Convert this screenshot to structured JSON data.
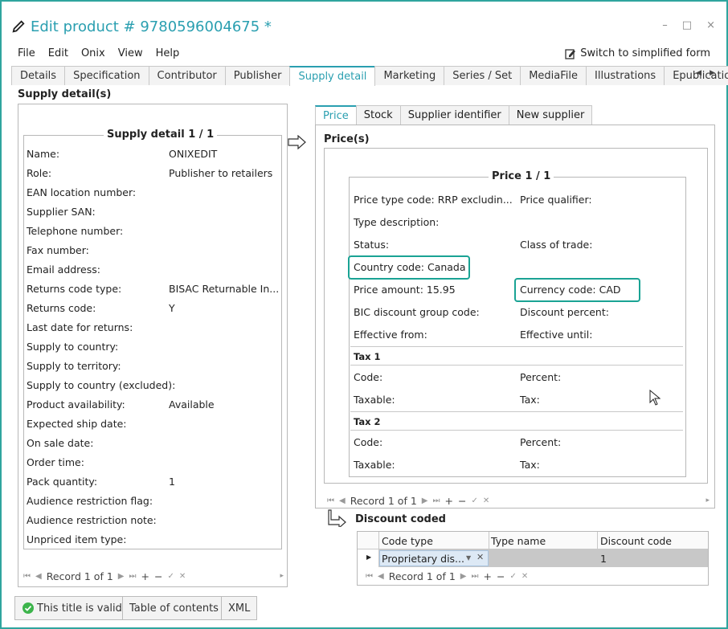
{
  "window": {
    "title": "Edit product # 9780596004675 *",
    "minimize": "–",
    "maximize": "□",
    "close": "×"
  },
  "menu": [
    "File",
    "Edit",
    "Onix",
    "View",
    "Help"
  ],
  "switch_label": "Switch to simplified form",
  "tabs": [
    "Details",
    "Specification",
    "Contributor",
    "Publisher",
    "Supply detail",
    "Marketing",
    "Series / Set",
    "MediaFile",
    "Illustrations",
    "Epublication"
  ],
  "left": {
    "section_title": "Supply detail(s)",
    "legend": "Supply detail 1 / 1",
    "fields": [
      {
        "label": "Name:",
        "value": "ONIXEDIT"
      },
      {
        "label": "Role:",
        "value": "Publisher to retailers"
      },
      {
        "label": "EAN location number:",
        "value": ""
      },
      {
        "label": "Supplier SAN:",
        "value": ""
      },
      {
        "label": "Telephone number:",
        "value": ""
      },
      {
        "label": "Fax number:",
        "value": ""
      },
      {
        "label": "Email address:",
        "value": ""
      },
      {
        "label": "Returns code type:",
        "value": "BISAC Returnable In..."
      },
      {
        "label": "Returns code:",
        "value": "Y"
      },
      {
        "label": "Last date for returns:",
        "value": ""
      },
      {
        "label": "Supply to country:",
        "value": ""
      },
      {
        "label": "Supply to territory:",
        "value": ""
      },
      {
        "label": "Supply to country (excluded):",
        "value": ""
      },
      {
        "label": "Product availability:",
        "value": "Available"
      },
      {
        "label": "Expected ship date:",
        "value": ""
      },
      {
        "label": "On sale date:",
        "value": ""
      },
      {
        "label": "Order time:",
        "value": ""
      },
      {
        "label": "Pack quantity:",
        "value": "1"
      },
      {
        "label": "Audience restriction flag:",
        "value": ""
      },
      {
        "label": "Audience restriction note:",
        "value": ""
      },
      {
        "label": "Unpriced item type:",
        "value": ""
      }
    ],
    "record": "Record 1 of 1"
  },
  "right": {
    "subtabs": [
      "Price",
      "Stock",
      "Supplier identifier",
      "New supplier"
    ],
    "section_title": "Price(s)",
    "legend": "Price 1 / 1",
    "price_type": "Price type code:  RRP excludin...",
    "price_qualifier": "Price qualifier:",
    "type_description": "Type description:",
    "status": "Status:",
    "class_of_trade": "Class of trade:",
    "country_code": "Country code:  Canada",
    "price_amount": "Price amount:  15.95",
    "currency_code": "Currency code:  CAD",
    "bic": "BIC discount group code:",
    "discount_percent": "Discount percent:",
    "effective_from": "Effective from:",
    "effective_until": "Effective until:",
    "tax1": "Tax 1",
    "tax2": "Tax 2",
    "code": "Code:",
    "percent": "Percent:",
    "taxable": "Taxable:",
    "tax": "Tax:",
    "record": "Record 1 of 1"
  },
  "discount": {
    "title": "Discount coded",
    "headers": [
      "Code type",
      "Type name",
      "Discount code"
    ],
    "row": {
      "code_type": "Proprietary dis...",
      "type_name": "",
      "discount_code": "1"
    },
    "record": "Record 1 of 1"
  },
  "bottom": {
    "valid": "This title is valid",
    "toc": "Table of contents",
    "xml": "XML"
  },
  "colors": {
    "accent": "#2a9fb0",
    "highlight": "#1aa394"
  }
}
